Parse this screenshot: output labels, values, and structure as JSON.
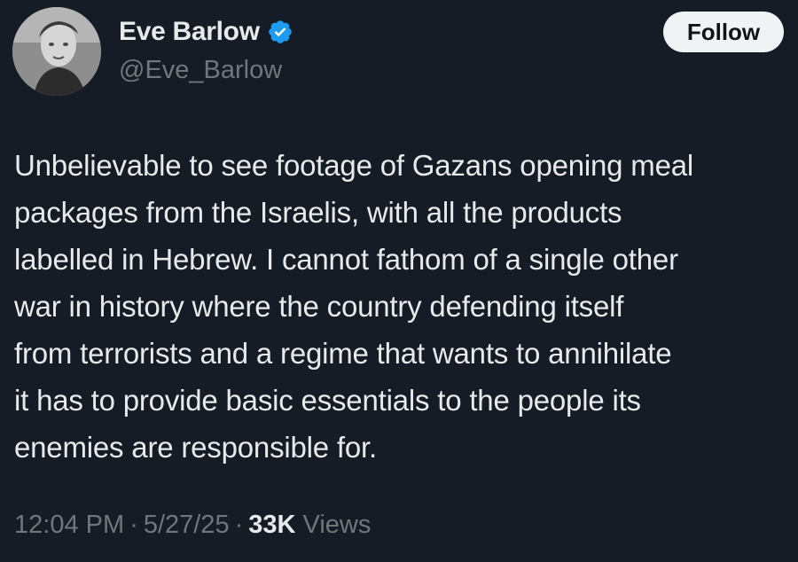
{
  "author": {
    "display_name": "Eve Barlow",
    "handle": "@Eve_Barlow",
    "verified_icon": "verified-badge-icon",
    "verified_color": "#1d9bf0"
  },
  "follow_button": {
    "label": "Follow"
  },
  "tweet": {
    "lines": [
      "Unbelievable to see footage of Gazans opening meal",
      "packages from the Israelis, with all the products",
      "labelled in Hebrew. I cannot fathom of a single other",
      "war in history where the country defending itself",
      "from terrorists and a regime that wants to annihilate",
      "it has to provide basic essentials to the people its",
      "enemies are responsible for."
    ]
  },
  "meta": {
    "time": "12:04 PM",
    "separator": "·",
    "date": "5/27/25",
    "views_count": "33K",
    "views_label": "Views"
  },
  "colors": {
    "background": "#151c25",
    "text_primary": "#e7e9ea",
    "text_secondary": "#71767b",
    "button_bg": "#eff3f4"
  }
}
